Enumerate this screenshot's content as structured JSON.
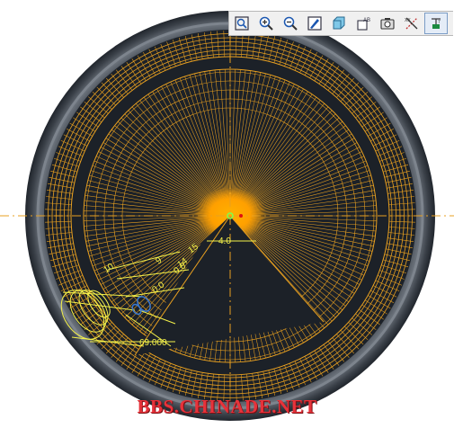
{
  "toolbar": {
    "buttons": [
      {
        "name": "refit-icon",
        "active": false
      },
      {
        "name": "zoom-in-icon",
        "active": false
      },
      {
        "name": "zoom-out-icon",
        "active": false
      },
      {
        "name": "repaint-icon",
        "active": false
      },
      {
        "name": "shading-icon",
        "active": false
      },
      {
        "name": "saved-view-icon",
        "active": false
      },
      {
        "name": "view-manager-icon",
        "active": false
      },
      {
        "name": "datum-display-icon",
        "active": false
      },
      {
        "name": "annotation-display-icon",
        "active": true
      }
    ]
  },
  "dimensions": {
    "center_offset": "4.0",
    "angle_1": "15",
    "angle_2": "14",
    "angle_3": "10",
    "angle_4": "9",
    "angle_5": "0.0",
    "angle_6": "0.0",
    "diameter": "69.000"
  },
  "watermark": {
    "text": "BBS.CHINADE.NET"
  },
  "colors": {
    "background": "#ffffff",
    "model_dark": "#1c2128",
    "tire_gray": "#5f6670",
    "mesh_orange": "#e8a020",
    "hub_orange": "#ffa000",
    "dimension_yellow": "#f5f24a",
    "selection_blue": "#3a78d0",
    "watermark_red": "#e8323a"
  }
}
